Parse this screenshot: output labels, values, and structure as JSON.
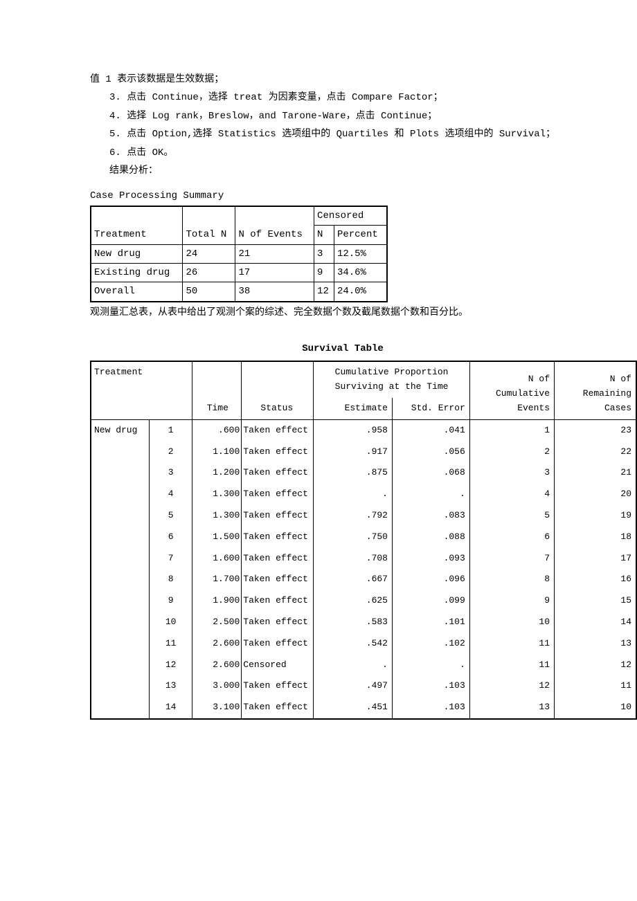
{
  "instructions": {
    "intro": "值 1 表示该数据是生效数据；",
    "steps": [
      "3. 点击 Continue，选择 treat 为因素变量，点击 Compare Factor；",
      "4. 选择 Log rank，Breslow，and Tarone-Ware，点击 Continue；",
      "5. 点击 Option,选择 Statistics 选项组中的 Quartiles 和 Plots 选项组中的 Survival；",
      "6. 点击 OK。"
    ],
    "result_label": "结果分析："
  },
  "case_summary": {
    "title": "Case Processing Summary",
    "headers": {
      "treatment": "Treatment",
      "total_n": "Total N",
      "n_events": "N of Events",
      "censored": "Censored",
      "n": "N",
      "percent": "Percent"
    },
    "rows": [
      {
        "treatment": "New drug",
        "total_n": "24",
        "n_events": "21",
        "n": "3",
        "percent": "12.5%"
      },
      {
        "treatment": "Existing drug",
        "total_n": "26",
        "n_events": "17",
        "n": "9",
        "percent": "34.6%"
      },
      {
        "treatment": "Overall",
        "total_n": "50",
        "n_events": "38",
        "n": "12",
        "percent": "24.0%"
      }
    ],
    "note": "观测量汇总表，从表中给出了观测个案的综述、完全数据个数及截尾数据个数和百分比。"
  },
  "survival": {
    "title": "Survival Table",
    "headers": {
      "treatment": "Treatment",
      "time": "Time",
      "status": "Status",
      "cum_prop": "Cumulative Proportion Surviving at the Time",
      "estimate": "Estimate",
      "std_error": "Std. Error",
      "n_cum": "N of Cumulative Events",
      "n_rem": "N of Remaining Cases"
    },
    "group_label": "New drug",
    "rows": [
      {
        "idx": "1",
        "time": ".600",
        "status": "Taken effect",
        "est": ".958",
        "err": ".041",
        "cum": "1",
        "rem": "23"
      },
      {
        "idx": "2",
        "time": "1.100",
        "status": "Taken effect",
        "est": ".917",
        "err": ".056",
        "cum": "2",
        "rem": "22"
      },
      {
        "idx": "3",
        "time": "1.200",
        "status": "Taken effect",
        "est": ".875",
        "err": ".068",
        "cum": "3",
        "rem": "21"
      },
      {
        "idx": "4",
        "time": "1.300",
        "status": "Taken effect",
        "est": ".",
        "err": ".",
        "cum": "4",
        "rem": "20"
      },
      {
        "idx": "5",
        "time": "1.300",
        "status": "Taken effect",
        "est": ".792",
        "err": ".083",
        "cum": "5",
        "rem": "19"
      },
      {
        "idx": "6",
        "time": "1.500",
        "status": "Taken effect",
        "est": ".750",
        "err": ".088",
        "cum": "6",
        "rem": "18"
      },
      {
        "idx": "7",
        "time": "1.600",
        "status": "Taken effect",
        "est": ".708",
        "err": ".093",
        "cum": "7",
        "rem": "17"
      },
      {
        "idx": "8",
        "time": "1.700",
        "status": "Taken effect",
        "est": ".667",
        "err": ".096",
        "cum": "8",
        "rem": "16"
      },
      {
        "idx": "9",
        "time": "1.900",
        "status": "Taken effect",
        "est": ".625",
        "err": ".099",
        "cum": "9",
        "rem": "15"
      },
      {
        "idx": "10",
        "time": "2.500",
        "status": "Taken effect",
        "est": ".583",
        "err": ".101",
        "cum": "10",
        "rem": "14"
      },
      {
        "idx": "11",
        "time": "2.600",
        "status": "Taken effect",
        "est": ".542",
        "err": ".102",
        "cum": "11",
        "rem": "13"
      },
      {
        "idx": "12",
        "time": "2.600",
        "status": "Censored",
        "est": ".",
        "err": ".",
        "cum": "11",
        "rem": "12"
      },
      {
        "idx": "13",
        "time": "3.000",
        "status": "Taken effect",
        "est": ".497",
        "err": ".103",
        "cum": "12",
        "rem": "11"
      },
      {
        "idx": "14",
        "time": "3.100",
        "status": "Taken effect",
        "est": ".451",
        "err": ".103",
        "cum": "13",
        "rem": "10"
      }
    ]
  }
}
